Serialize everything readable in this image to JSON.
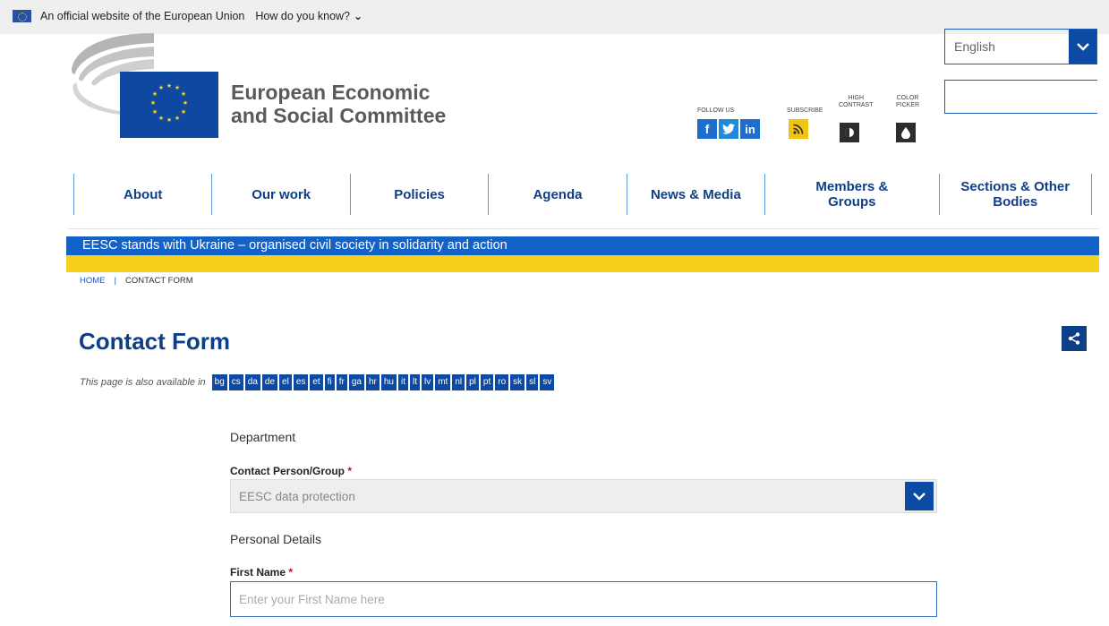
{
  "eu_bar": {
    "official_text": "An official website of the European Union",
    "how_know": "How do you know?"
  },
  "logo": {
    "line1": "European Economic",
    "line2": "and Social Committee"
  },
  "tools": {
    "follow_us": "FOLLOW US",
    "subscribe": "SUBSCRIBE",
    "high_contrast_1": "HIGH",
    "high_contrast_2": "CONTRAST",
    "color_picker_1": "COLOR",
    "color_picker_2": "PICKER",
    "icons": [
      "facebook-icon",
      "twitter-icon",
      "linkedin-icon",
      "rss-icon",
      "contrast-icon",
      "color-drop-icon"
    ]
  },
  "language_select": {
    "value": "English"
  },
  "search": {
    "placeholder": ""
  },
  "nav": [
    {
      "label": "About"
    },
    {
      "label": "Our work"
    },
    {
      "label": "Policies"
    },
    {
      "label": "Agenda"
    },
    {
      "label": "News & Media"
    },
    {
      "label": "Members & Groups"
    },
    {
      "label": "Sections & Other Bodies"
    }
  ],
  "banner": {
    "text": "EESC stands with Ukraine – organised civil society in solidarity and action"
  },
  "breadcrumb": {
    "home": "HOME",
    "separator": "|",
    "current": "CONTACT FORM"
  },
  "page": {
    "title": "Contact Form",
    "available_label": "This page is also available in",
    "languages": [
      "bg",
      "cs",
      "da",
      "de",
      "el",
      "es",
      "et",
      "fi",
      "fr",
      "ga",
      "hr",
      "hu",
      "it",
      "lt",
      "lv",
      "mt",
      "nl",
      "pl",
      "pt",
      "ro",
      "sk",
      "sl",
      "sv"
    ]
  },
  "form": {
    "department_title": "Department",
    "contact_label": "Contact Person/Group",
    "contact_value": "EESC data protection",
    "required_mark": "*",
    "personal_title": "Personal Details",
    "first_name_label": "First Name",
    "first_name_placeholder": "Enter your First Name here"
  },
  "colors": {
    "primary": "#0d4aa3",
    "title": "#0e3f86",
    "ukraine_blue": "#1262c7",
    "ukraine_yellow": "#f6d11b"
  }
}
